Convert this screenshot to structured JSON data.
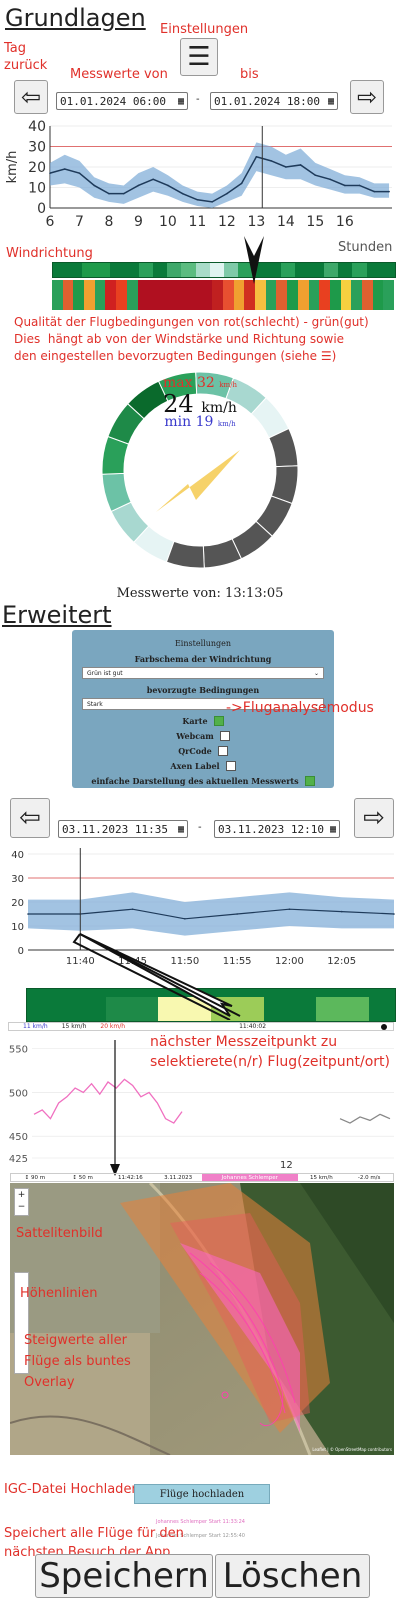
{
  "sections": {
    "basics_title": "Grundlagen",
    "advanced_title": "Erweitert"
  },
  "annotations": {
    "settings": "Einstellungen",
    "day_back": "Tag\nzurück",
    "values_from": "Messwerte von",
    "until": "bis",
    "wind_direction": "Windrichtung",
    "quality": "Qualität der Flugbedingungen von rot(schlecht) - grün(gut)\nDies  hängt ab von der Windstärke und Richtung sowie\nden eingestellen bevorzugten Bedingungen (siehe ☰)",
    "flight_analysis": "->Fluganalysemodus",
    "nearest_point": "nächster Messzeitpunkt zu\nselektierete(n/r) Flug(zeitpunt/ort)",
    "satellite": "Sattelitenbild",
    "contours": "Höhenlinien",
    "climb_overlay": "Steigwerte aller\nFlüge als buntes\nOverlay",
    "igc_upload": "IGC-Datei Hochladen",
    "saves_all": "Speichert alle Flüge für den\nnächsten Besuch der App"
  },
  "toolbar1": {
    "from": "01.01.2024 06:00",
    "to": "01.01.2024 18:00",
    "prev_icon": "arrow-left-icon",
    "next_icon": "arrow-right-icon",
    "menu_icon": "hamburger-icon"
  },
  "chart1": {
    "type": "line",
    "ylabel": "km/h",
    "xlabel": "Stunden",
    "x_ticks": [
      "6",
      "7",
      "8",
      "9",
      "10",
      "11",
      "12",
      "13",
      "14",
      "15",
      "16"
    ],
    "y_ticks": [
      "0",
      "10",
      "20",
      "30",
      "40"
    ],
    "ylim": [
      0,
      40
    ],
    "threshold": 30,
    "cursor_x": 13.2,
    "x": [
      6,
      6.5,
      7,
      7.5,
      8,
      8.5,
      9,
      9.5,
      10,
      10.5,
      11,
      11.5,
      12,
      12.5,
      13,
      13.5,
      14,
      14.5,
      15,
      15.5,
      16,
      16.5,
      17,
      17.5
    ],
    "mean": [
      17,
      19,
      17,
      11,
      7,
      7,
      11,
      14,
      11,
      7,
      4,
      3,
      7,
      12,
      25,
      23,
      20,
      21,
      16,
      14,
      11,
      11,
      8,
      8
    ],
    "min": [
      11,
      12,
      10,
      5,
      3,
      2,
      5,
      8,
      6,
      3,
      1,
      0,
      3,
      6,
      18,
      16,
      14,
      14,
      11,
      9,
      7,
      7,
      5,
      5
    ],
    "max": [
      22,
      26,
      23,
      15,
      12,
      11,
      17,
      20,
      16,
      11,
      8,
      7,
      11,
      17,
      32,
      30,
      26,
      29,
      22,
      19,
      16,
      15,
      12,
      12
    ]
  },
  "wind_colors1": [
    "#0a7a3a",
    "#0a7a3a",
    "#1e9a4a",
    "#1e9a4a",
    "#0a7a3a",
    "#0a7a3a",
    "#2aa05a",
    "#0a7a3a",
    "#3ea86a",
    "#5cbc80",
    "#a8dcc8",
    "#e0f4f0",
    "#7fcaa8",
    "#2aa05a",
    "#0a7a3a",
    "#0a7a3a",
    "#2aa05a",
    "#0a7a3a",
    "#0a7a3a",
    "#3ea86a",
    "#0a7a3a",
    "#2aa05a",
    "#0a7a3a",
    "#0a7a3a"
  ],
  "quality_colors1": [
    "#2aa05a",
    "#e06030",
    "#1e9a4a",
    "#f0a030",
    "#2aa05a",
    "#d02020",
    "#e84020",
    "#2aa05a",
    "#b01020",
    "#b01020",
    "#b01020",
    "#b01020",
    "#b01020",
    "#b01020",
    "#b01020",
    "#c02020",
    "#e85030",
    "#f0a030",
    "#d03020",
    "#f6c040",
    "#2aa05a",
    "#e06030",
    "#1e9a4a",
    "#f0a030",
    "#2aa05a",
    "#e84020",
    "#1e9a4a",
    "#f6d040",
    "#2aa05a",
    "#e06030",
    "#1e9a4a",
    "#2aa05a"
  ],
  "gauge": {
    "max_label": "max",
    "max_value": "32",
    "current": "24",
    "min_label": "min",
    "min_value": "19",
    "unit": "km/h",
    "timestamp": "Messwerte von: 13:13:05",
    "segments": [
      "#e6f4f4",
      "#a8d8d0",
      "#6cc2a6",
      "#2aa05a",
      "#1e8a48",
      "#0a6a2c",
      "#2aa05a",
      "#6cc2a6",
      "#a8d8d0",
      "#e6f4f4",
      "#555555",
      "#555555",
      "#555555",
      "#555555",
      "#555555",
      "#555555"
    ]
  },
  "settings_panel": {
    "title": "Einstellungen",
    "color_scheme_label": "Farbschema der Windrichtung",
    "color_scheme_value": "Grün ist gut",
    "preferred_label": "bevorzugte Bedingungen",
    "preferred_value": "Stark",
    "map_label": "Karte",
    "webcam_label": "Webcam",
    "qrcode_label": "QrCode",
    "axis_label": "Axen Label",
    "simple_label": "einfache Darstellung des aktuellen Messwerts",
    "map_checked": true,
    "webcam_checked": false,
    "qrcode_checked": false,
    "axis_checked": false,
    "simple_checked": true
  },
  "toolbar2": {
    "from": "03.11.2023 11:35",
    "to": "03.11.2023 12:10"
  },
  "chart2": {
    "type": "line",
    "x_ticks": [
      "11:40",
      "11:45",
      "11:50",
      "11:55",
      "12:00",
      "12:05"
    ],
    "y_ticks": [
      "0",
      "10",
      "20",
      "30",
      "40"
    ],
    "ylim": [
      0,
      40
    ],
    "threshold": 30,
    "cursor": "11:40",
    "x": [
      "11:35",
      "11:40",
      "11:45",
      "11:50",
      "11:55",
      "12:00",
      "12:05",
      "12:10"
    ],
    "mean": [
      15,
      15,
      17,
      13,
      15,
      17,
      16,
      15
    ],
    "min": [
      9,
      8,
      9,
      6,
      8,
      10,
      9,
      9
    ],
    "max": [
      21,
      21,
      24,
      20,
      22,
      24,
      22,
      21
    ]
  },
  "wind_colors2": [
    "#0a7a3a",
    "#0a7a3a",
    "#0a7a3a",
    "#1e8a48",
    "#1e8a48",
    "#f8f8b0",
    "#f8f8b0",
    "#9ccc58",
    "#9ccc58",
    "#0a7a3a",
    "#0a7a3a",
    "#5cb85c",
    "#5cb85c",
    "#0a7a3a"
  ],
  "legend_strip": {
    "a": "11 km/h",
    "b": "15 km/h",
    "c": "20 km/h",
    "d": "11:40:02"
  },
  "altitude_chart": {
    "y_ticks": [
      "550",
      "500",
      "450",
      "425"
    ],
    "ylim": [
      425,
      560
    ],
    "flight1": [
      475,
      480,
      470,
      488,
      495,
      505,
      500,
      510,
      498,
      512,
      505,
      515,
      508,
      495,
      500,
      488,
      470,
      465,
      478
    ],
    "flight2": [
      470,
      465,
      472,
      468,
      475,
      470
    ]
  },
  "map_bar": {
    "items": [
      "↕ 90 m",
      "↕ 50 m",
      "11:42:16",
      "3.11.2023",
      "Johannes Schlemper",
      "15 km/h",
      "-2.0 m/s"
    ],
    "number": "12",
    "attribution": "Leaflet | © OpenStreetMap contributors"
  },
  "upload": {
    "button": "Flüge hochladen",
    "file1": "Johannes Schlemper Start 11:33:24",
    "file2": "Johannes Schlemper Start 12:55:40"
  },
  "actions": {
    "save": "Speichern",
    "delete": "Löschen"
  }
}
